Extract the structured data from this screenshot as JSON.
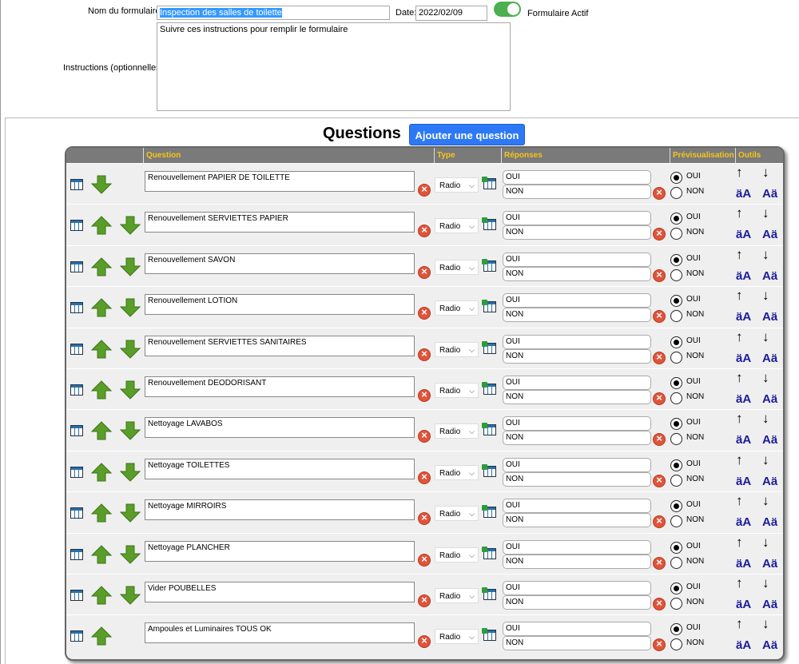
{
  "form": {
    "name_label": "Nom du formulaire:",
    "name_value": "Inspection des salles de toilette",
    "date_label": "Date:",
    "date_value": "2022/02/09",
    "active_label": "Formulaire Actif",
    "active": true,
    "instructions_label": "Instructions (optionnelles):",
    "instructions_value": "Suivre ces instructions pour remplir le formulaire"
  },
  "questions": {
    "title": "Questions",
    "add_button": "Ajouter une question",
    "headers": {
      "question": "Question",
      "type": "Type",
      "answers": "Réponses",
      "preview": "Prévisualisation",
      "tools": "Outils"
    },
    "rows": [
      {
        "text": "Renouvellement PAPIER DE TOILETTE",
        "type": "Radio",
        "answers": [
          "OUI",
          "NON"
        ],
        "up": false,
        "down": true
      },
      {
        "text": "Renouvellement SERVIETTES PAPIER",
        "type": "Radio",
        "answers": [
          "OUI",
          "NON"
        ],
        "up": true,
        "down": true
      },
      {
        "text": "Renouvellement SAVON",
        "type": "Radio",
        "answers": [
          "OUI",
          "NON"
        ],
        "up": true,
        "down": true
      },
      {
        "text": "Renouvellement LOTION",
        "type": "Radio",
        "answers": [
          "OUI",
          "NON"
        ],
        "up": true,
        "down": true
      },
      {
        "text": "Renouvellement SERVIETTES SANITAIRES",
        "type": "Radio",
        "answers": [
          "OUI",
          "NON"
        ],
        "up": true,
        "down": true
      },
      {
        "text": "Renouvellement DEODORISANT",
        "type": "Radio",
        "answers": [
          "OUI",
          "NON"
        ],
        "up": true,
        "down": true
      },
      {
        "text": "Nettoyage LAVABOS",
        "type": "Radio",
        "answers": [
          "OUI",
          "NON"
        ],
        "up": true,
        "down": true
      },
      {
        "text": "Nettoyage TOILETTES",
        "type": "Radio",
        "answers": [
          "OUI",
          "NON"
        ],
        "up": true,
        "down": true
      },
      {
        "text": "Nettoyage MIRROIRS",
        "type": "Radio",
        "answers": [
          "OUI",
          "NON"
        ],
        "up": true,
        "down": true
      },
      {
        "text": "Nettoyage PLANCHER",
        "type": "Radio",
        "answers": [
          "OUI",
          "NON"
        ],
        "up": true,
        "down": true
      },
      {
        "text": "Vider POUBELLES",
        "type": "Radio",
        "answers": [
          "OUI",
          "NON"
        ],
        "up": true,
        "down": true
      },
      {
        "text": "Ampoules et Luminaires TOUS OK",
        "type": "Radio",
        "answers": [
          "OUI",
          "NON"
        ],
        "up": true,
        "down": false
      }
    ],
    "preview_selected": "OUI",
    "tool_labels": [
      "↑",
      "↓",
      "äA",
      "Aä"
    ]
  },
  "colors": {
    "header_text": "#f5c518",
    "add_button_bg": "#2d78f5",
    "toggle_on": "#4caf50",
    "arrow_green": "#5a9e2a"
  }
}
